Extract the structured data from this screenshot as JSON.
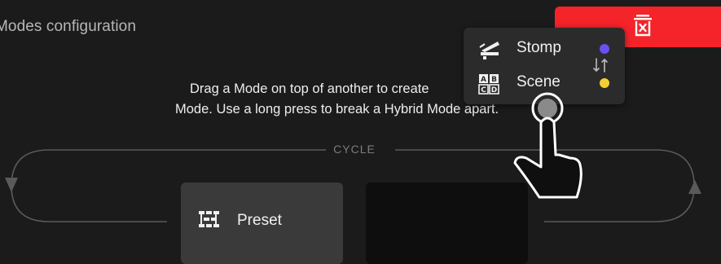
{
  "page": {
    "title": "Modes configuration"
  },
  "delete_zone": {
    "icon": "trash-icon",
    "color": "#f5232a"
  },
  "instruction": {
    "line1": "Drag a Mode on top of another to create",
    "line2": "Mode. Use a long press to break a Hybrid Mode apart."
  },
  "cycle": {
    "label": "CYCLE"
  },
  "cards": [
    {
      "label": "Preset",
      "icon": "preset-grid-icon"
    },
    {
      "label": "",
      "icon": ""
    }
  ],
  "hybrid_popup": {
    "items": [
      {
        "label": "Stomp",
        "icon": "stomp-pedal-icon",
        "dot_color": "#6a50f0"
      },
      {
        "label": "Scene",
        "icon": "scene-abcd-icon",
        "dot_color": "#f4cf33"
      }
    ],
    "swap_icon": "swap-arrows-icon"
  },
  "gesture": {
    "icon": "pointing-hand-icon"
  }
}
